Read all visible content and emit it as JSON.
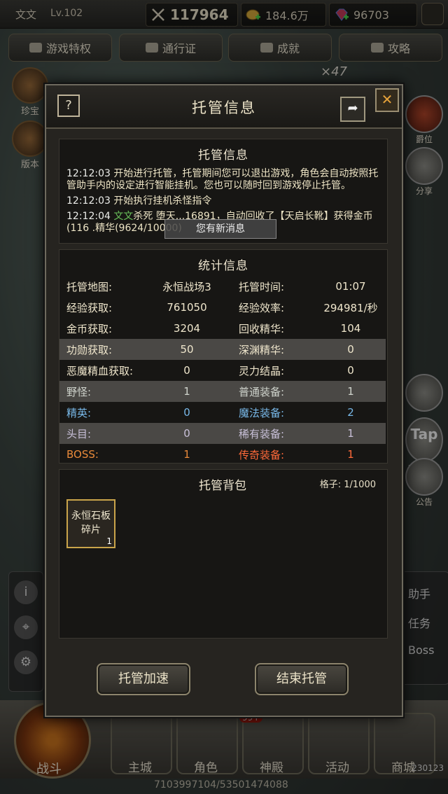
{
  "topbar": {
    "player_name": "文文",
    "level": "Lv.102",
    "power": "117964",
    "gold": "184.6万",
    "gems": "96703"
  },
  "nav": [
    "游戏特权",
    "通行证",
    "成就",
    "攻略"
  ],
  "count_badge": "×47",
  "left_icons": [
    "珍宝",
    "版本"
  ],
  "right_icons": {
    "rank": "爵位",
    "share": "分享",
    "tap": "Tap",
    "tap_label": "Tap社区",
    "notice": "公告"
  },
  "right_panel": [
    "助手",
    "任务",
    "Boss"
  ],
  "bottom_tabs": {
    "battle": "战斗",
    "tabs": [
      "主城",
      "角色",
      "神殿",
      "活动",
      "商城"
    ],
    "badge": "99+"
  },
  "footer_id": "7103997104/53501474088",
  "corner_number": "230123",
  "dialog": {
    "title": "托管信息",
    "help": "?",
    "close": "✕",
    "log_section": {
      "title": "托管信息",
      "entries": [
        {
          "time": "12:12:03",
          "text": "开始进行托管，托管期间您可以退出游戏，角色会自动按照托管助手内的设定进行智能挂机。您也可以随时回到游戏停止托管。"
        },
        {
          "time": "12:12:03",
          "text": "开始执行挂机杀怪指令"
        },
        {
          "time": "12:12:04",
          "name": "文文",
          "text": "杀死 堕天...16891，自动回收了【天启长靴】获得金币(116 .精华(9624/10000)"
        }
      ],
      "toast": "您有新消息"
    },
    "stats_section": {
      "title": "统计信息",
      "rows": [
        {
          "l1": "托管地图:",
          "v1": "永恒战场3",
          "l2": "托管时间:",
          "v2": "01:07",
          "style": ""
        },
        {
          "l1": "经验获取:",
          "v1": "761050",
          "l2": "经验效率:",
          "v2": "294981/秒",
          "style": ""
        },
        {
          "l1": "金币获取:",
          "v1": "3204",
          "l2": "回收精华:",
          "v2": "104",
          "style": ""
        },
        {
          "l1": "功勋获取:",
          "v1": "50",
          "l2": "深渊精华:",
          "v2": "0",
          "style": "shade"
        },
        {
          "l1": "恶魔精血获取:",
          "v1": "0",
          "l2": "灵力结晶:",
          "v2": "0",
          "style": ""
        },
        {
          "l1": "野怪:",
          "v1": "1",
          "l2": "普通装备:",
          "v2": "1",
          "style": "shade c-green"
        },
        {
          "l1": "精英:",
          "v1": "0",
          "l2": "魔法装备:",
          "v2": "2",
          "style": "c-blue"
        },
        {
          "l1": "头目:",
          "v1": "0",
          "l2": "稀有装备:",
          "v2": "1",
          "style": "shade c-purple"
        },
        {
          "l1": "BOSS:",
          "v1": "1",
          "l2": "传奇装备:",
          "v2": "1",
          "style": "c-orange"
        }
      ]
    },
    "bag_section": {
      "title": "托管背包",
      "slots": "格子: 1/1000",
      "items": [
        {
          "name": "永恒石板碎片",
          "qty": "1"
        }
      ]
    },
    "buttons": {
      "speed_up": "托管加速",
      "end": "结束托管"
    }
  }
}
